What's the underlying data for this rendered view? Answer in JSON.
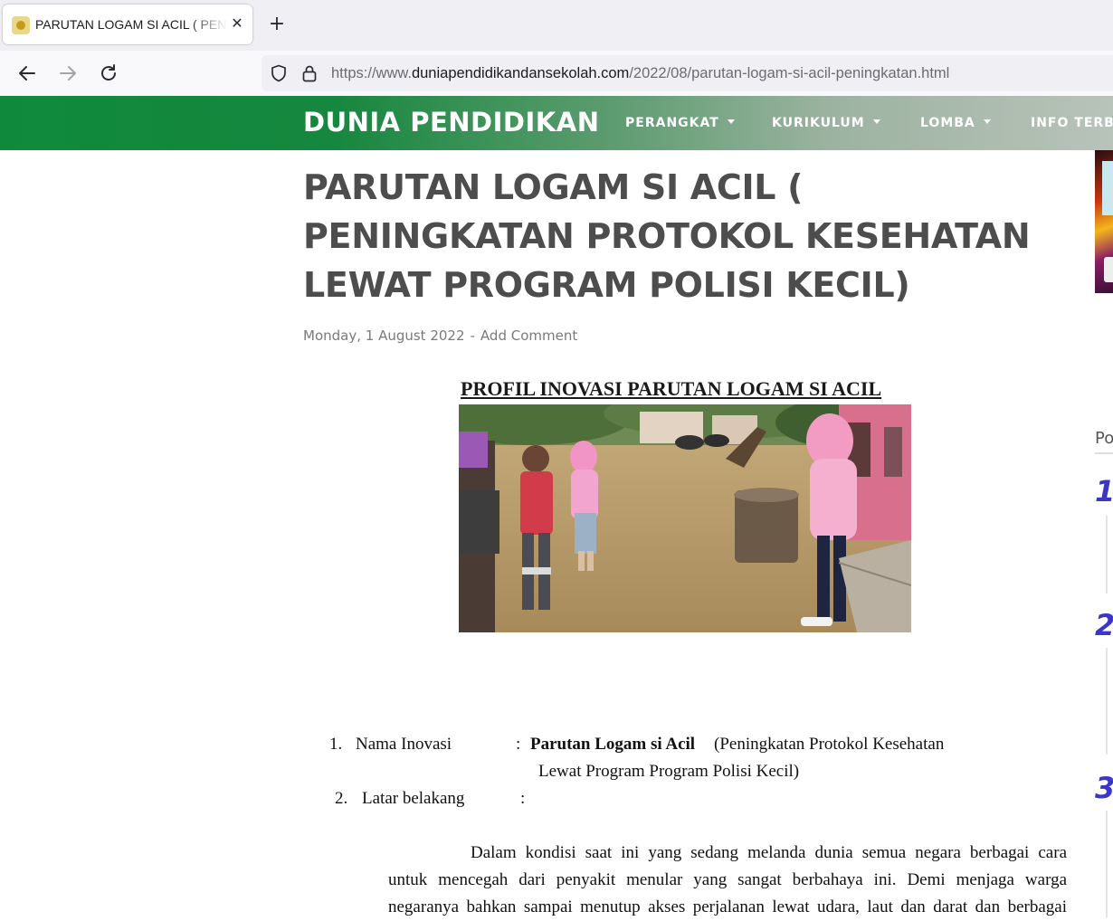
{
  "browser": {
    "tab_title": "PARUTAN LOGAM SI ACIL ( PENINGKATAN PROTOKOL KESEHATAN LEWAT PROGRAM POLISI KECIL)",
    "tab_close": "✕",
    "new_tab": "+",
    "url_scheme": "https://www.",
    "url_host": "duniapendidikandansekolah.com",
    "url_path": "/2022/08/parutan-logam-si-acil-peningkatan.html"
  },
  "site": {
    "title": "DUNIA PENDIDIKAN",
    "menu": [
      {
        "label": "PERANGKAT"
      },
      {
        "label": "KURIKULUM"
      },
      {
        "label": "LOMBA"
      },
      {
        "label": "INFO TERBA"
      }
    ]
  },
  "post": {
    "title": "PARUTAN LOGAM SI ACIL ( PENINGKATAN PROTOKOL KESEHATAN LEWAT PROGRAM POLISI KECIL)",
    "date": "Monday, 1 August 2022",
    "separator": "-",
    "comment_link": "Add Comment"
  },
  "document": {
    "heading": "PROFIL INOVASI PARUTAN LOGAM SI ACIL",
    "item1_number": "1.",
    "item1_label": "Nama Inovasi",
    "item1_colon": ":",
    "item1_value_bold": "Parutan Logam si Acil",
    "item1_value_rest": "(Peningkatan Protokol Kesehatan",
    "item1_value_line2": "Lewat Program Program Polisi Kecil)",
    "item2_number": "2.",
    "item2_label": "Latar belakang",
    "item2_colon": ":",
    "paragraph_lines": [
      "Dalam kondisi saat ini yang sedang melanda dunia semua negara berbagai cara",
      "untuk mencegah dari penyakit menular yang sangat berbahaya ini. Demi menjaga warga",
      "negaranya bahkan sampai menutup akses perjalanan lewat udara, laut dan darat dan berbagai"
    ]
  },
  "sidebar": {
    "heading": "Po",
    "numbers": [
      "1",
      "2",
      "3"
    ]
  }
}
